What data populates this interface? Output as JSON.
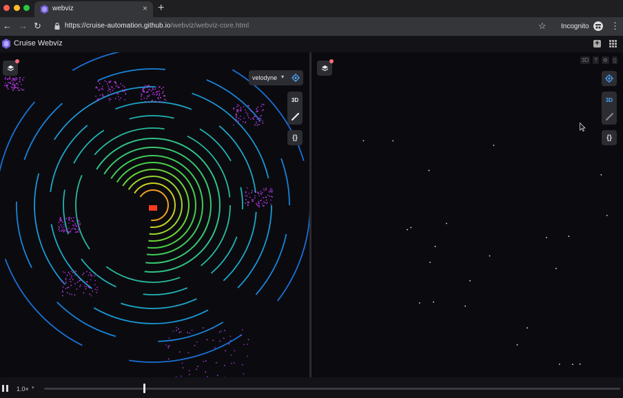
{
  "browser": {
    "tab_title": "webviz",
    "tab_close": "×",
    "new_tab": "+",
    "url_host": "https://cruise-automation.github.io",
    "url_path": "/webviz/webviz-core.html",
    "incognito_label": "Incognito"
  },
  "app": {
    "title": "Cruise Webviz",
    "add_panel": "+"
  },
  "left_panel": {
    "camera_select": "velodyne",
    "view_mode": "3D",
    "topics_icon": "{}"
  },
  "right_panel": {
    "view_mode": "3D",
    "topics_icon": "{}",
    "panel_toolbar": [
      "3D",
      "?",
      "⚙",
      "▯"
    ]
  },
  "playback": {
    "speed": "1.0×",
    "progress_fraction": 0.174
  },
  "colors": {
    "accent": "#4aa8ff",
    "alert_dot": "#ff6b7a",
    "brand_purple": "#6f5bd3"
  },
  "icons": [
    "layers-icon",
    "target-icon",
    "ruler-icon",
    "pause-icon",
    "grid-icon",
    "lock-icon",
    "star-icon"
  ]
}
